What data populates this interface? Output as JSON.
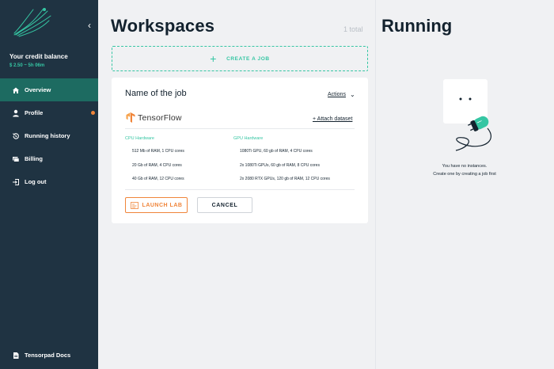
{
  "sidebar": {
    "credit_title": "Your credit balance",
    "credit_value": "$ 2.50 ~ 5h 06m",
    "items": [
      {
        "label": "Overview",
        "icon": "home-icon"
      },
      {
        "label": "Profile",
        "icon": "user-icon"
      },
      {
        "label": "Running history",
        "icon": "history-icon"
      },
      {
        "label": "Billing",
        "icon": "billing-icon"
      },
      {
        "label": "Log out",
        "icon": "logout-icon"
      }
    ],
    "docs_label": "Tensorpad Docs"
  },
  "workspaces": {
    "title": "Workspaces",
    "total": "1 total",
    "create_job": "CREATE A JOB"
  },
  "job": {
    "name": "Name of the job",
    "actions": "Actions",
    "framework": "TensorFlow",
    "attach": "+ Attach dataset",
    "cpu_header": "CPU Hardware",
    "gpu_header": "GPU Hardware",
    "cpu_options": [
      "512 Mb of RAM, 1 CPU cores",
      "20 Gb of RAM, 4 CPU cores",
      "40 Gb of RAM, 12 CPU cores"
    ],
    "gpu_options": [
      "1080Ti GPU, 60 gb of RAM, 4 CPU cores",
      "2x 1080Ti GPUs, 60 gb of RAM, 8 CPU cores",
      "2x 2080 RTX GPUs, 120 gb of RAM, 12 CPU cores"
    ],
    "launch": "LAUNCH LAB",
    "cancel": "CANCEL"
  },
  "running": {
    "title": "Running",
    "empty_line1": "You have no instances.",
    "empty_line2": "Create one by creating a job first"
  },
  "colors": {
    "sidebar_bg": "#1f3342",
    "active_bg": "#1d6b61",
    "accent": "#35c6a3",
    "orange": "#f0853a"
  }
}
